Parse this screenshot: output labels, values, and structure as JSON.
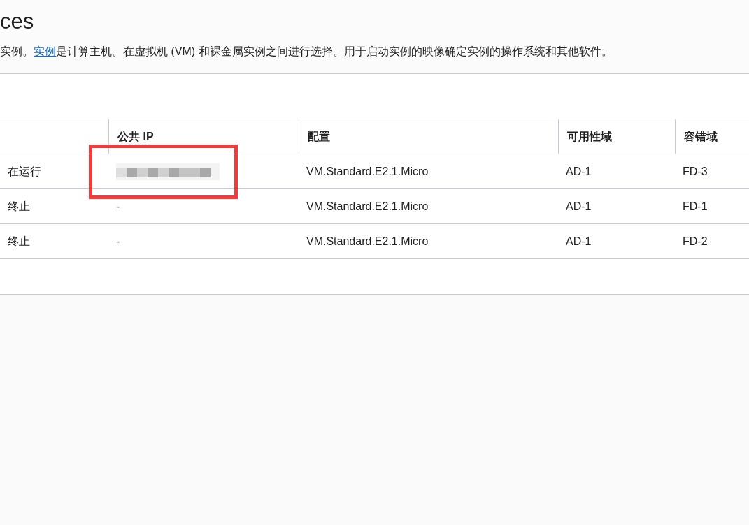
{
  "page_title": "ces",
  "description": {
    "before": "实例。",
    "link": "实例",
    "after": "是计算主机。在虚拟机 (VM) 和裸金属实例之间进行选择。用于启动实例的映像确定实例的操作系统和其他软件。"
  },
  "table": {
    "columns": [
      "",
      "公共 IP",
      "配置",
      "可用性域",
      "容错域"
    ],
    "rows": [
      {
        "status": "在运行",
        "public_ip": {
          "kind": "blurred"
        },
        "shape": "VM.Standard.E2.1.Micro",
        "availability_domain": "AD-1",
        "fault_domain": "FD-3"
      },
      {
        "status": "终止",
        "public_ip": {
          "kind": "text",
          "text": "-"
        },
        "shape": "VM.Standard.E2.1.Micro",
        "availability_domain": "AD-1",
        "fault_domain": "FD-1"
      },
      {
        "status": "终止",
        "public_ip": {
          "kind": "text",
          "text": "-"
        },
        "shape": "VM.Standard.E2.1.Micro",
        "availability_domain": "AD-1",
        "fault_domain": "FD-2"
      }
    ]
  },
  "annotation": {
    "kind": "highlight_box"
  }
}
